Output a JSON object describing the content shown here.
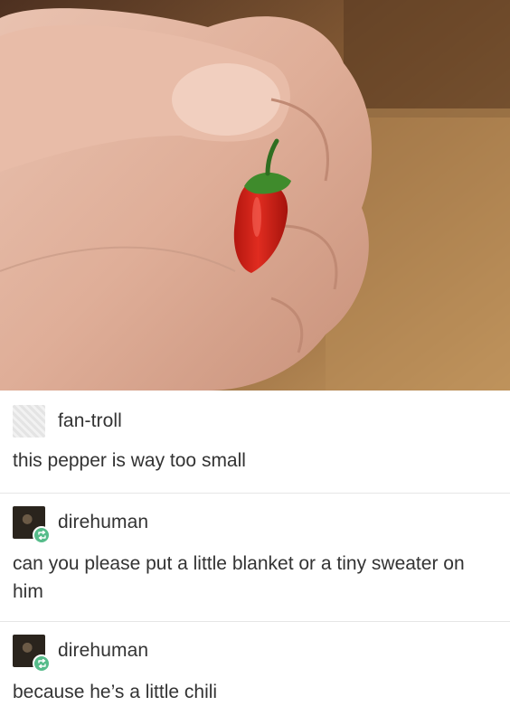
{
  "image": {
    "description_icon": "photo-hand-holding-tiny-pepper-icon"
  },
  "posts": [
    {
      "username": "fan-troll",
      "avatar": "blurred-avatar",
      "reblog_badge": false,
      "text": "this pepper is way too small"
    },
    {
      "username": "direhuman",
      "avatar": "direhuman-avatar",
      "reblog_badge": true,
      "text": "can you please put a little blanket or a tiny sweater on him"
    },
    {
      "username": "direhuman",
      "avatar": "direhuman-avatar",
      "reblog_badge": true,
      "text": "because he’s a little chili"
    }
  ],
  "colors": {
    "reblog_green": "#56bc8a",
    "pepper_red": "#d8231b",
    "stem_green": "#3f8b2c"
  }
}
